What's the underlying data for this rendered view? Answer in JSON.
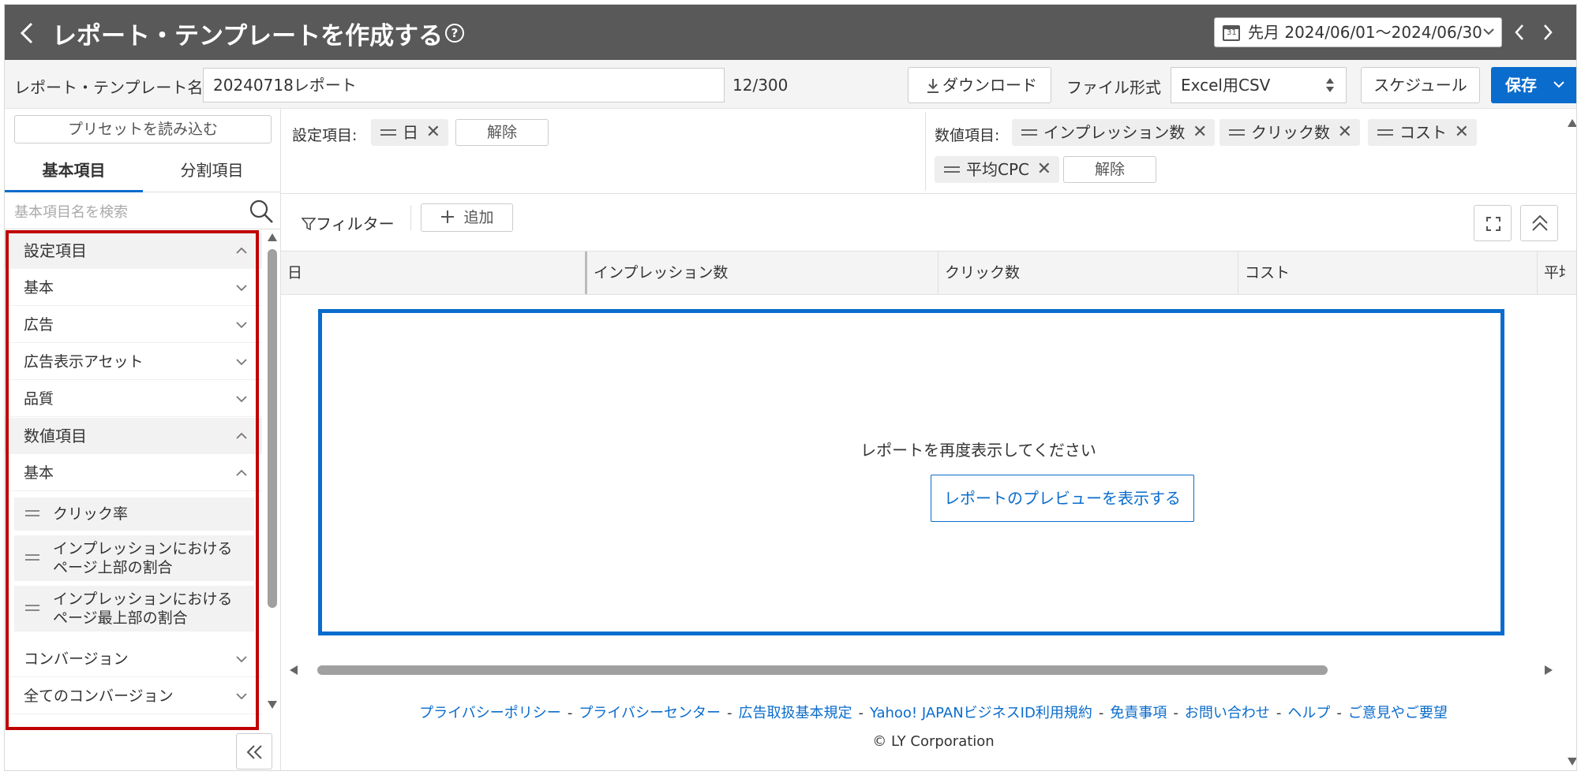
{
  "header": {
    "title": "レポート・テンプレートを作成する",
    "help_icon": "?",
    "date_range": "先月 2024/06/01〜2024/06/30"
  },
  "toolbar": {
    "name_label": "レポート・テンプレート名",
    "name_value": "20240718レポート",
    "counter": "12/300",
    "download_label": "ダウンロード",
    "format_label": "ファイル形式",
    "format_value": "Excel用CSV",
    "schedule_label": "スケジュール",
    "save_label": "保存"
  },
  "sidebar": {
    "preset_label": "プリセットを読み込む",
    "tabs": [
      {
        "label": "基本項目"
      },
      {
        "label": "分割項目"
      }
    ],
    "search_placeholder": "基本項目名を検索",
    "sections": [
      {
        "label": "設定項目"
      },
      {
        "label": "数値項目"
      }
    ],
    "rows": [
      {
        "label": "基本"
      },
      {
        "label": "広告"
      },
      {
        "label": "広告表示アセット"
      },
      {
        "label": "品質"
      },
      {
        "label": "基本"
      },
      {
        "label": "コンバージョン"
      },
      {
        "label": "全てのコンバージョン"
      }
    ],
    "items": [
      {
        "label": "クリック率"
      },
      {
        "label": "インプレッションにおけるページ上部の割合"
      },
      {
        "label": "インプレッションにおけるページ最上部の割合"
      }
    ]
  },
  "conditions": {
    "settings_label": "設定項目:",
    "settings_chips": [
      {
        "label": "日"
      }
    ],
    "settings_clear": "解除",
    "numeric_label": "数値項目:",
    "numeric_chips": [
      {
        "label": "インプレッション数"
      },
      {
        "label": "クリック数"
      },
      {
        "label": "コスト"
      },
      {
        "label": "平均CPC"
      }
    ],
    "numeric_clear": "解除"
  },
  "filter": {
    "filter_label": "フィルター",
    "add_label": "追加"
  },
  "table": {
    "columns": [
      "日",
      "インプレッション数",
      "クリック数",
      "コスト",
      "平均"
    ]
  },
  "empty_state": {
    "message": "レポートを再度表示してください",
    "preview_button": "レポートのプレビューを表示する"
  },
  "footer": {
    "links": [
      "プライバシーポリシー",
      "プライバシーセンター",
      "広告取扱基本規定",
      "Yahoo! JAPANビジネスID利用規約",
      "免責事項",
      "お問い合わせ",
      "ヘルプ",
      "ご意見やご要望"
    ],
    "copyright": "© LY Corporation"
  },
  "colors": {
    "header_bg": "#595959",
    "accent": "#0a6ccc",
    "highlight": "#c00000"
  }
}
